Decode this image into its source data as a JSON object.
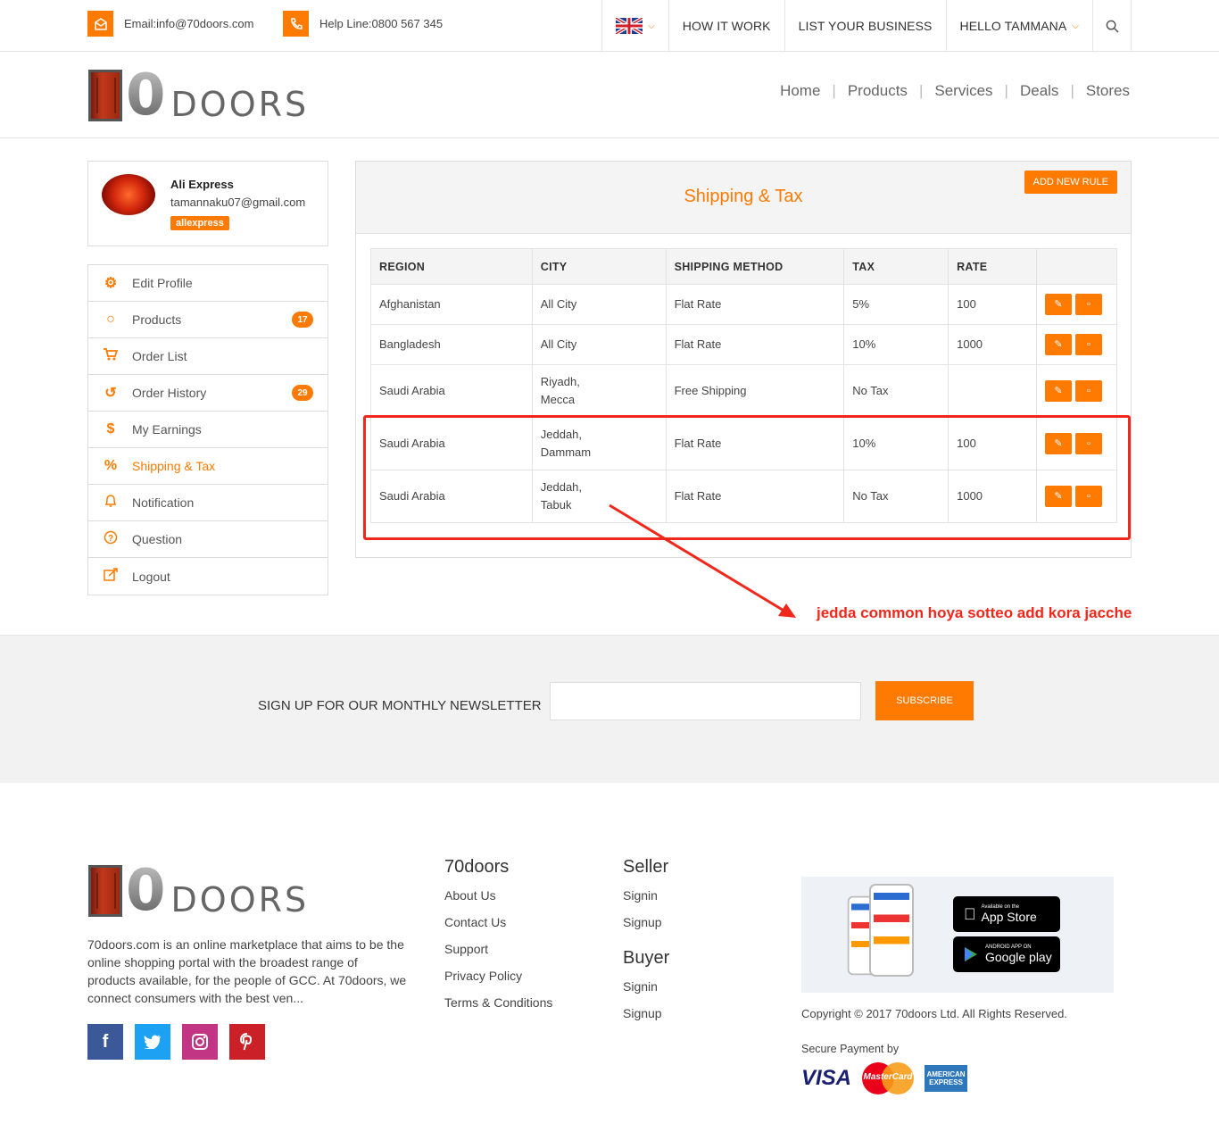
{
  "topbar": {
    "email": "Email:info@70doors.com",
    "helpline": "Help Line:0800 567 345",
    "nav": [
      "HOW IT WORK",
      "LIST YOUR BUSINESS",
      "HELLO TAMMANA"
    ]
  },
  "logo": {
    "number": "70",
    "word": "DOORS"
  },
  "mainnav": [
    "Home",
    "Products",
    "Services",
    "Deals",
    "Stores"
  ],
  "profile": {
    "name": "Ali Express",
    "email": "tamannaku07@gmail.com",
    "badge": "allexpress"
  },
  "sidebar": {
    "items": [
      {
        "label": "Edit Profile",
        "icon": "gear-icon"
      },
      {
        "label": "Products",
        "icon": "circle-icon",
        "count": "17"
      },
      {
        "label": "Order List",
        "icon": "cart-icon"
      },
      {
        "label": "Order History",
        "icon": "history-icon",
        "count": "29"
      },
      {
        "label": "My Earnings",
        "icon": "dollar-icon"
      },
      {
        "label": "Shipping & Tax",
        "icon": "percent-icon",
        "active": true
      },
      {
        "label": "Notification",
        "icon": "bell-icon"
      },
      {
        "label": "Question",
        "icon": "question-icon"
      },
      {
        "label": "Logout",
        "icon": "logout-icon"
      }
    ]
  },
  "panel": {
    "title": "Shipping & Tax",
    "add_button": "ADD NEW RULE",
    "columns": [
      "REGION",
      "CITY",
      "SHIPPING METHOD",
      "TAX",
      "RATE"
    ],
    "rows": [
      {
        "region": "Afghanistan",
        "city": [
          "All City"
        ],
        "method": "Flat Rate",
        "tax": "5%",
        "rate": "100"
      },
      {
        "region": "Bangladesh",
        "city": [
          "All City"
        ],
        "method": "Flat Rate",
        "tax": "10%",
        "rate": "1000"
      },
      {
        "region": "Saudi Arabia",
        "city": [
          "Riyadh,",
          "Mecca"
        ],
        "method": "Free Shipping",
        "tax": "No Tax",
        "rate": ""
      },
      {
        "region": "Saudi Arabia",
        "city": [
          "Jeddah,",
          "Dammam"
        ],
        "method": "Flat Rate",
        "tax": "10%",
        "rate": "100"
      },
      {
        "region": "Saudi Arabia",
        "city": [
          "Jeddah,",
          "Tabuk"
        ],
        "method": "Flat Rate",
        "tax": "No Tax",
        "rate": "1000"
      }
    ]
  },
  "annotation": "jedda common hoya sotteo add kora jacche",
  "newsletter": {
    "label": "SIGN UP FOR OUR MONTHLY NEWSLETTER",
    "button": "SUBSCRIBE"
  },
  "footer": {
    "about": "70doors.com is an online marketplace that aims to be the online shopping portal with the broadest range of products available, for the people of GCC. At 70doors, we connect consumers with the best ven...",
    "col1": {
      "title": "70doors",
      "links": [
        "About Us",
        "Contact Us",
        "Support",
        "Privacy Policy",
        "Terms & Conditions"
      ]
    },
    "seller": {
      "title": "Seller",
      "links": [
        "Signin",
        "Signup"
      ]
    },
    "buyer": {
      "title": "Buyer",
      "links": [
        "Signin",
        "Signup"
      ]
    },
    "appstore": {
      "small": "Available on the",
      "big": "App Store"
    },
    "googleplay": {
      "small": "ANDROID APP ON",
      "big": "Google play"
    },
    "copyright": "Copyright © 2017 70doors Ltd. All Rights Reserved.",
    "secure": "Secure Payment by",
    "payments": [
      "VISA",
      "MasterCard",
      "AMERICAN EXPRESS"
    ],
    "social": [
      "facebook-icon",
      "twitter-icon",
      "instagram-icon",
      "pinterest-icon"
    ]
  }
}
